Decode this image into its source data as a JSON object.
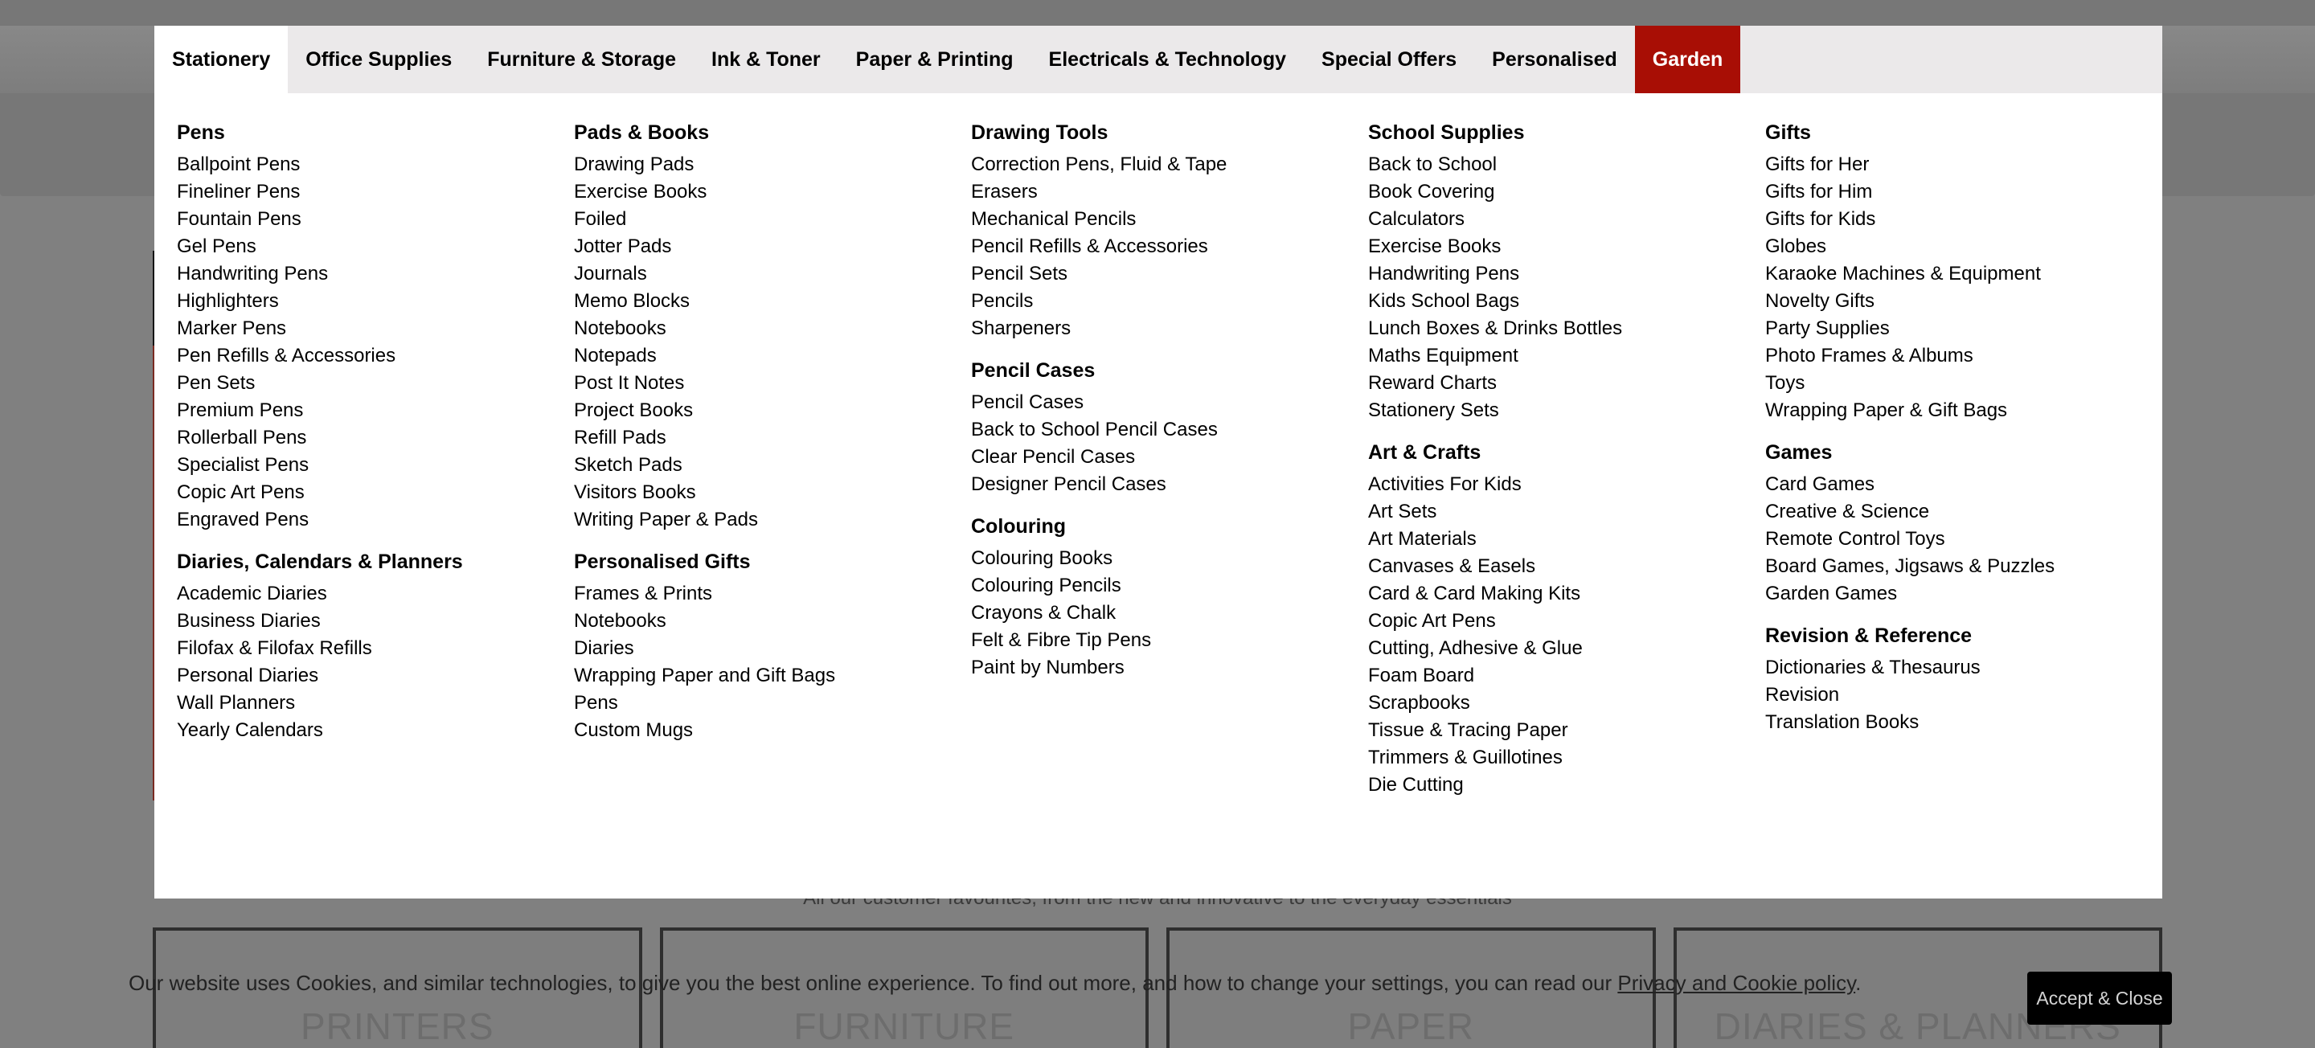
{
  "background": {
    "tagline": "All our customer favourites, from the new and innovative to the everyday essentials",
    "cards": [
      "PRINTERS",
      "FURNITURE",
      "PAPER",
      "DIARIES & PLANNERS"
    ]
  },
  "nav": {
    "tabs": [
      {
        "label": "Stationery",
        "state": "active"
      },
      {
        "label": "Office Supplies"
      },
      {
        "label": "Furniture & Storage"
      },
      {
        "label": "Ink & Toner"
      },
      {
        "label": "Paper & Printing"
      },
      {
        "label": "Electricals & Technology"
      },
      {
        "label": "Special Offers"
      },
      {
        "label": "Personalised"
      },
      {
        "label": "Garden",
        "highlight_color": "#a80e05"
      }
    ]
  },
  "menu": {
    "columns": [
      {
        "groups": [
          {
            "heading": "Pens",
            "items": [
              "Ballpoint Pens",
              "Fineliner Pens",
              "Fountain Pens",
              "Gel Pens",
              "Handwriting Pens",
              "Highlighters",
              "Marker Pens",
              "Pen Refills & Accessories",
              "Pen Sets",
              "Premium Pens",
              "Rollerball Pens",
              "Specialist Pens",
              "Copic Art Pens",
              "Engraved Pens"
            ]
          },
          {
            "heading": "Diaries, Calendars & Planners",
            "items": [
              "Academic Diaries",
              "Business Diaries",
              "Filofax & Filofax Refills",
              "Personal Diaries",
              "Wall Planners",
              "Yearly Calendars"
            ]
          }
        ]
      },
      {
        "groups": [
          {
            "heading": "Pads & Books",
            "items": [
              "Drawing Pads",
              "Exercise Books",
              "Foiled",
              "Jotter Pads",
              "Journals",
              "Memo Blocks",
              "Notebooks",
              "Notepads",
              "Post It Notes",
              "Project Books",
              "Refill Pads",
              "Sketch Pads",
              "Visitors Books",
              "Writing Paper & Pads"
            ]
          },
          {
            "heading": "Personalised Gifts",
            "items": [
              "Frames & Prints",
              "Notebooks",
              "Diaries",
              "Wrapping Paper and Gift Bags",
              "Pens",
              "Custom Mugs"
            ]
          }
        ]
      },
      {
        "groups": [
          {
            "heading": "Drawing Tools",
            "items": [
              "Correction Pens, Fluid & Tape",
              "Erasers",
              "Mechanical Pencils",
              "Pencil Refills & Accessories",
              "Pencil Sets",
              "Pencils",
              "Sharpeners"
            ]
          },
          {
            "heading": "Pencil Cases",
            "items": [
              "Pencil Cases",
              "Back to School Pencil Cases",
              "Clear Pencil Cases",
              "Designer Pencil Cases"
            ]
          },
          {
            "heading": "Colouring",
            "items": [
              "Colouring Books",
              "Colouring Pencils",
              "Crayons & Chalk",
              "Felt & Fibre Tip Pens",
              "Paint by Numbers"
            ]
          }
        ]
      },
      {
        "groups": [
          {
            "heading": "School Supplies",
            "items": [
              "Back to School",
              "Book Covering",
              "Calculators",
              "Exercise Books",
              "Handwriting Pens",
              "Kids School Bags",
              "Lunch Boxes & Drinks Bottles",
              "Maths Equipment",
              "Reward Charts",
              "Stationery Sets"
            ]
          },
          {
            "heading": "Art & Crafts",
            "items": [
              "Activities For Kids",
              "Art Sets",
              "Art Materials",
              "Canvases & Easels",
              "Card & Card Making Kits",
              "Copic Art Pens",
              "Cutting, Adhesive & Glue",
              "Foam Board",
              "Scrapbooks",
              "Tissue & Tracing Paper",
              "Trimmers & Guillotines",
              "Die Cutting"
            ]
          }
        ]
      },
      {
        "groups": [
          {
            "heading": "Gifts",
            "items": [
              "Gifts for Her",
              "Gifts for Him",
              "Gifts for Kids",
              "Globes",
              "Karaoke Machines & Equipment",
              "Novelty Gifts",
              "Party Supplies",
              "Photo Frames & Albums",
              "Toys",
              "Wrapping Paper & Gift Bags"
            ]
          },
          {
            "heading": "Games",
            "items": [
              "Card Games",
              "Creative & Science",
              "Remote Control Toys",
              "Board Games, Jigsaws & Puzzles",
              "Garden Games"
            ]
          },
          {
            "heading": "Revision & Reference",
            "items": [
              "Dictionaries & Thesaurus",
              "Revision",
              "Translation Books"
            ]
          }
        ]
      }
    ]
  },
  "cookie": {
    "text": "Our website uses Cookies, and similar technologies, to give you the best online experience. To find out more, and how to change your settings, you can read our ",
    "link_label": "Privacy and Cookie policy",
    "suffix": ".",
    "accept_label": "Accept & Close"
  }
}
